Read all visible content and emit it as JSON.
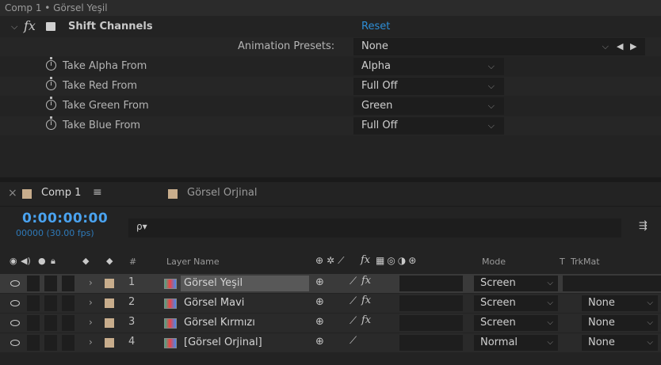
{
  "effect_controls": {
    "title": "Comp 1 • Görsel Yeşil",
    "effect_name": "Shift Channels",
    "fx_label": "fx",
    "reset_label": "Reset",
    "presets_label": "Animation Presets:",
    "presets_value": "None",
    "properties": [
      {
        "label": "Take Alpha From",
        "value": "Alpha"
      },
      {
        "label": "Take Red From",
        "value": "Full Off"
      },
      {
        "label": "Take Green From",
        "value": "Green"
      },
      {
        "label": "Take Blue From",
        "value": "Full Off"
      }
    ]
  },
  "timeline": {
    "tabs": [
      {
        "label": "Comp 1",
        "color": "#c8ad8c"
      },
      {
        "label": "Görsel Orjinal",
        "color": "#c8ad8c"
      }
    ],
    "menu_glyph": "≡",
    "close_glyph": "×",
    "timecode": "0:00:00:00",
    "frames": "00000 (30.00 fps)",
    "search_icon": "ρ▾",
    "columns": {
      "hash": "#",
      "layer_name": "Layer Name",
      "mode": "Mode",
      "t": "T",
      "trkmat": "TrkMat"
    },
    "layers": [
      {
        "num": "1",
        "name": "Görsel Yeşil",
        "mode": "Screen",
        "trkmat": "",
        "fx": "fx",
        "selected": true
      },
      {
        "num": "2",
        "name": "Görsel Mavi",
        "mode": "Screen",
        "trkmat": "None",
        "fx": "fx",
        "selected": false
      },
      {
        "num": "3",
        "name": "Görsel Kırmızı",
        "mode": "Screen",
        "trkmat": "None",
        "fx": "fx",
        "selected": false
      },
      {
        "num": "4",
        "name": "[Görsel Orjinal]",
        "mode": "Normal",
        "trkmat": "None",
        "fx": "",
        "selected": false
      }
    ]
  }
}
